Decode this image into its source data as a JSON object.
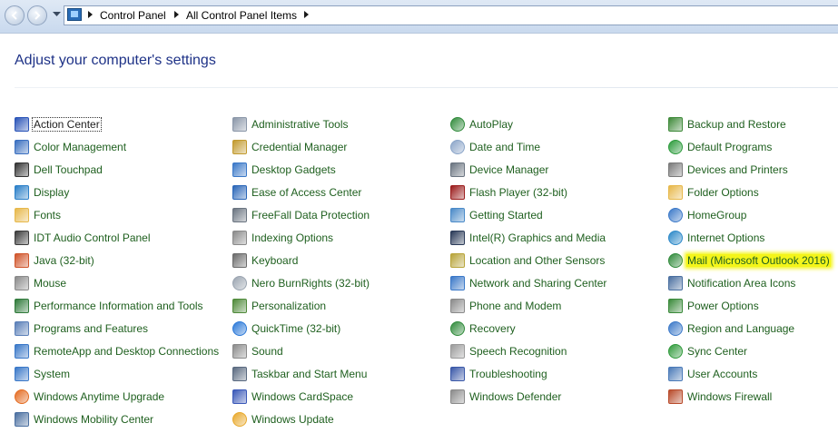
{
  "breadcrumb": [
    "Control Panel",
    "All Control Panel Items"
  ],
  "page_title": "Adjust your computer's settings",
  "colors": {
    "link": "#1e5f1e",
    "title": "#1e3287",
    "highlight": "#f4f51a"
  },
  "columns": [
    [
      {
        "label": "Action Center",
        "icon": "flag-icon",
        "color": "#2a54b8"
      },
      {
        "label": "Color Management",
        "icon": "monitor-icon",
        "color": "#3a6fc0"
      },
      {
        "label": "Dell Touchpad",
        "icon": "touchpad-icon",
        "color": "#333333"
      },
      {
        "label": "Display",
        "icon": "display-icon",
        "color": "#2a7fc8"
      },
      {
        "label": "Fonts",
        "icon": "folder-icon",
        "color": "#e7b84a"
      },
      {
        "label": "IDT Audio Control Panel",
        "icon": "audio-icon",
        "color": "#3b3b3b"
      },
      {
        "label": "Java (32-bit)",
        "icon": "java-icon",
        "color": "#d0542a"
      },
      {
        "label": "Mouse",
        "icon": "mouse-icon",
        "color": "#8a8a8a"
      },
      {
        "label": "Performance Information and Tools",
        "icon": "performance-icon",
        "color": "#2f7a3a"
      },
      {
        "label": "Programs and Features",
        "icon": "programs-icon",
        "color": "#5a7fb8"
      },
      {
        "label": "RemoteApp and Desktop Connections",
        "icon": "remote-desktop-icon",
        "color": "#3a78c8"
      },
      {
        "label": "System",
        "icon": "system-icon",
        "color": "#3a78c8"
      },
      {
        "label": "Windows Anytime Upgrade",
        "icon": "windows-logo-icon",
        "color": "#e46a1f"
      },
      {
        "label": "Windows Mobility Center",
        "icon": "mobility-icon",
        "color": "#4a6fa0"
      }
    ],
    [
      {
        "label": "Administrative Tools",
        "icon": "gear-icon",
        "color": "#8a96a8"
      },
      {
        "label": "Credential Manager",
        "icon": "vault-icon",
        "color": "#c29a2e"
      },
      {
        "label": "Desktop Gadgets",
        "icon": "gadgets-icon",
        "color": "#3a78c8"
      },
      {
        "label": "Ease of Access Center",
        "icon": "accessibility-icon",
        "color": "#2a66b8"
      },
      {
        "label": "FreeFall Data Protection",
        "icon": "drive-icon",
        "color": "#6a7480"
      },
      {
        "label": "Indexing Options",
        "icon": "indexing-icon",
        "color": "#8a8a8a"
      },
      {
        "label": "Keyboard",
        "icon": "keyboard-icon",
        "color": "#6a6a6a"
      },
      {
        "label": "Nero BurnRights (32-bit)",
        "icon": "disc-icon",
        "color": "#9aa4b0"
      },
      {
        "label": "Personalization",
        "icon": "personalization-icon",
        "color": "#4f8a3a"
      },
      {
        "label": "QuickTime (32-bit)",
        "icon": "quicktime-icon",
        "color": "#2a78d8"
      },
      {
        "label": "Sound",
        "icon": "speaker-icon",
        "color": "#8a8a8a"
      },
      {
        "label": "Taskbar and Start Menu",
        "icon": "taskbar-icon",
        "color": "#5a6a80"
      },
      {
        "label": "Windows CardSpace",
        "icon": "cardspace-icon",
        "color": "#3a58b8"
      },
      {
        "label": "Windows Update",
        "icon": "windows-update-icon",
        "color": "#e8a82a"
      }
    ],
    [
      {
        "label": "AutoPlay",
        "icon": "autoplay-icon",
        "color": "#2f8a3a"
      },
      {
        "label": "Date and Time",
        "icon": "clock-icon",
        "color": "#8aa4c8"
      },
      {
        "label": "Device Manager",
        "icon": "device-manager-icon",
        "color": "#6a7480"
      },
      {
        "label": "Flash Player (32-bit)",
        "icon": "flash-icon",
        "color": "#9b1c1c"
      },
      {
        "label": "Getting Started",
        "icon": "getting-started-icon",
        "color": "#4a8ac8"
      },
      {
        "label": "Intel(R) Graphics and Media",
        "icon": "intel-icon",
        "color": "#2a3a58"
      },
      {
        "label": "Location and Other Sensors",
        "icon": "sensors-icon",
        "color": "#b8a43a"
      },
      {
        "label": "Network and Sharing Center",
        "icon": "network-icon",
        "color": "#3a78c8"
      },
      {
        "label": "Phone and Modem",
        "icon": "phone-icon",
        "color": "#8a8a8a"
      },
      {
        "label": "Recovery",
        "icon": "recovery-icon",
        "color": "#2f8a3a"
      },
      {
        "label": "Speech Recognition",
        "icon": "microphone-icon",
        "color": "#9a9a9a"
      },
      {
        "label": "Troubleshooting",
        "icon": "troubleshooting-icon",
        "color": "#3a58a8"
      },
      {
        "label": "Windows Defender",
        "icon": "defender-icon",
        "color": "#8a8a8a"
      }
    ],
    [
      {
        "label": "Backup and Restore",
        "icon": "backup-icon",
        "color": "#3f8a3a"
      },
      {
        "label": "Default Programs",
        "icon": "default-programs-icon",
        "color": "#2a9a3a"
      },
      {
        "label": "Devices and Printers",
        "icon": "printer-icon",
        "color": "#7a7a7a"
      },
      {
        "label": "Folder Options",
        "icon": "folder-options-icon",
        "color": "#e7b84a"
      },
      {
        "label": "HomeGroup",
        "icon": "homegroup-icon",
        "color": "#3a78c8"
      },
      {
        "label": "Internet Options",
        "icon": "internet-icon",
        "color": "#2a88c8"
      },
      {
        "label": "Mail (Microsoft Outlook 2016)",
        "icon": "mail-icon",
        "color": "#2f8a3a"
      },
      {
        "label": "Notification Area Icons",
        "icon": "notification-icon",
        "color": "#4a6fa0"
      },
      {
        "label": "Power Options",
        "icon": "power-icon",
        "color": "#3a8a3a"
      },
      {
        "label": "Region and Language",
        "icon": "globe-icon",
        "color": "#3a78c8"
      },
      {
        "label": "Sync Center",
        "icon": "sync-icon",
        "color": "#2f9a3a"
      },
      {
        "label": "User Accounts",
        "icon": "users-icon",
        "color": "#4a7ab8"
      },
      {
        "label": "Windows Firewall",
        "icon": "firewall-icon",
        "color": "#b84a2a"
      }
    ]
  ]
}
